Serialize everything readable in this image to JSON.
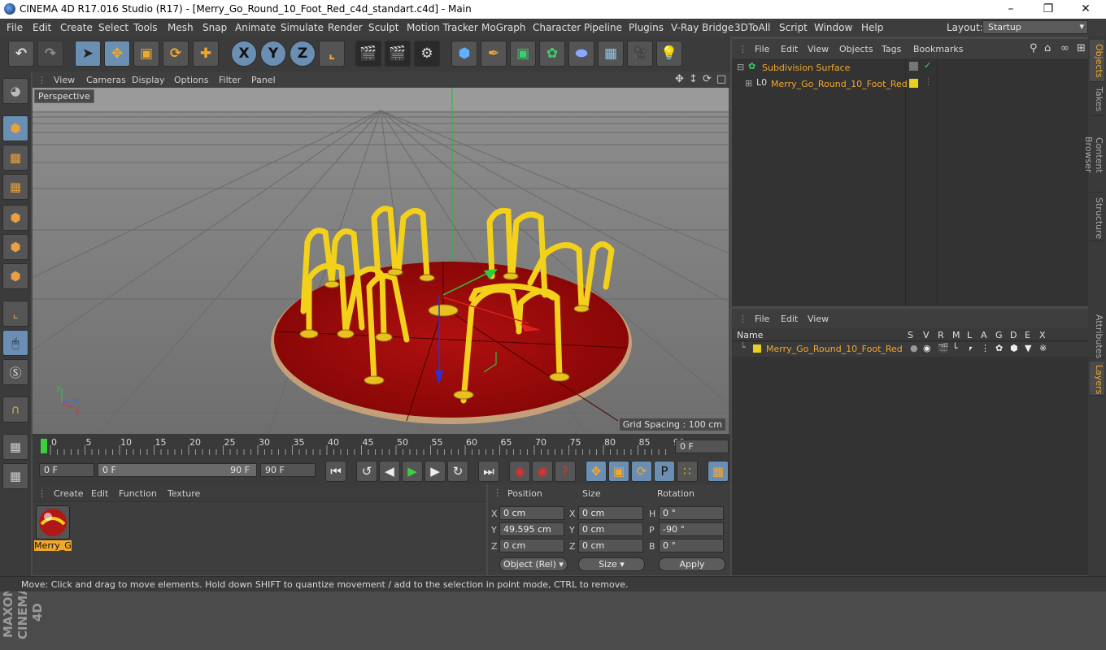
{
  "window": {
    "title": "CINEMA 4D R17.016 Studio (R17) - [Merry_Go_Round_10_Foot_Red_c4d_standart.c4d] - Main",
    "minimize": "–",
    "maximize": "❐",
    "close": "✕"
  },
  "menubar": {
    "items": [
      "File",
      "Edit",
      "Create",
      "Select",
      "Tools",
      "Mesh",
      "Snap",
      "Animate",
      "Simulate",
      "Render",
      "Sculpt",
      "Motion Tracker",
      "MoGraph",
      "Character",
      "Pipeline",
      "Plugins",
      "V-Ray Bridge",
      "3DToAll",
      "Script",
      "Window",
      "Help"
    ],
    "layout_label": "Layout:",
    "layout_value": "Startup"
  },
  "toolbar": {
    "icons": [
      "undo-icon",
      "redo-icon",
      "select-icon",
      "move-icon",
      "scale-icon",
      "rotate-icon",
      "move-alt-icon",
      "x-axis-icon",
      "y-axis-icon",
      "z-axis-icon",
      "world-coords-icon",
      "render-view-icon",
      "render-picture-queue-icon",
      "render-settings-icon",
      "cube-icon",
      "pen-icon",
      "subdivision-icon",
      "mograph-cloner-icon",
      "deformer-icon",
      "floor-icon",
      "camera-icon",
      "light-icon"
    ],
    "axis_labels": [
      "X",
      "Y",
      "Z"
    ]
  },
  "viewport_menu": {
    "items": [
      "View",
      "Cameras",
      "Display",
      "Options",
      "Filter",
      "Panel"
    ]
  },
  "viewport": {
    "label": "Perspective",
    "grid_spacing": "Grid Spacing : 100 cm",
    "axis_x": "x",
    "axis_y": "y",
    "axis_z": "z"
  },
  "timeline": {
    "ticks": [
      "0",
      "5",
      "10",
      "15",
      "20",
      "25",
      "30",
      "35",
      "40",
      "45",
      "50",
      "55",
      "60",
      "65",
      "70",
      "75",
      "80",
      "85",
      "90"
    ],
    "current_frame_field": "0 F"
  },
  "playback": {
    "start_field": "0 F",
    "range_start": "0 F",
    "range_end": "90 F",
    "end_field": "90 F"
  },
  "material_panel": {
    "menu": [
      "Create",
      "Edit",
      "Function",
      "Texture"
    ],
    "material_name": "Merry_G"
  },
  "coordinates": {
    "headers": [
      "Position",
      "Size",
      "Rotation"
    ],
    "rows": [
      {
        "pos_label": "X",
        "pos": "0 cm",
        "size_label": "X",
        "size": "0 cm",
        "rot_label": "H",
        "rot": "0 °"
      },
      {
        "pos_label": "Y",
        "pos": "49.595 cm",
        "size_label": "Y",
        "size": "0 cm",
        "rot_label": "P",
        "rot": "-90 °"
      },
      {
        "pos_label": "Z",
        "pos": "0 cm",
        "size_label": "Z",
        "size": "0 cm",
        "rot_label": "B",
        "rot": "0 °"
      }
    ],
    "mode_dropdown": "Object (Rel)",
    "size_dropdown": "Size",
    "apply_label": "Apply"
  },
  "object_manager": {
    "menu": [
      "File",
      "Edit",
      "View",
      "Objects",
      "Tags",
      "Bookmarks"
    ],
    "objects": [
      {
        "name": "Subdivision Surface",
        "color": "#f2a82c"
      },
      {
        "name": "Merry_Go_Round_10_Foot_Red",
        "color": "#f2a82c"
      }
    ]
  },
  "layer_manager": {
    "menu": [
      "File",
      "Edit",
      "View"
    ],
    "columns": [
      "Name",
      "S",
      "V",
      "R",
      "M",
      "L",
      "A",
      "G",
      "D",
      "E",
      "X"
    ],
    "layer_name": "Merry_Go_Round_10_Foot_Red"
  },
  "right_tabs": [
    "Objects",
    "Takes",
    "Content Browser",
    "Structure",
    "Attributes",
    "Layers"
  ],
  "status": {
    "text": "Move: Click and drag to move elements. Hold down SHIFT to quantize movement / add to the selection in point mode, CTRL to remove."
  },
  "branding": "MAXON CINEMA 4D",
  "colors": {
    "accent_orange": "#f2a82c",
    "active_blue": "#6b8fb3",
    "platform_red": "#b30c0c",
    "bar_yellow": "#f3d11b"
  }
}
